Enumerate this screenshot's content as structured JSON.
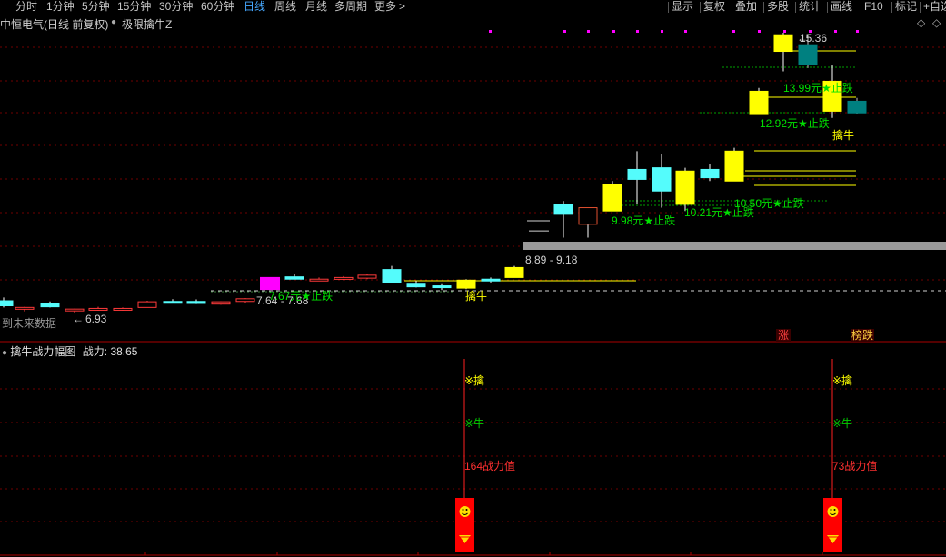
{
  "toolbar": {
    "tabs": [
      {
        "label": "分时",
        "active": false
      },
      {
        "label": "1分钟",
        "active": false
      },
      {
        "label": "5分钟",
        "active": false
      },
      {
        "label": "15分钟",
        "active": false
      },
      {
        "label": "30分钟",
        "active": false
      },
      {
        "label": "60分钟",
        "active": false
      },
      {
        "label": "日线",
        "active": true
      },
      {
        "label": "周线",
        "active": false
      },
      {
        "label": "月线",
        "active": false
      },
      {
        "label": "多周期",
        "active": false
      },
      {
        "label": "更多",
        "active": false
      }
    ],
    "more_arrow": ">",
    "right_buttons": [
      "显示",
      "复权",
      "叠加",
      "多股",
      "统计",
      "画线",
      "F10",
      "标记",
      "+自选"
    ]
  },
  "infobar": {
    "stock_title": "中恒电气(日线 前复权)",
    "indicator_name": "极限擒牛Z"
  },
  "price_panel": {
    "future_data_label": "到未来数据",
    "low_label": "6.93",
    "high_label": "15.36",
    "range_labels": [
      "7.64 - 7.68",
      "8.89 - 9.18"
    ],
    "stop_labels": [
      "7.67元★止跌",
      "9.98元★止跌",
      "10.21元★止跌",
      "10.50元★止跌",
      "12.92元★止跌",
      "13.99元★止跌"
    ],
    "signal_labels": [
      "擒牛",
      "擒牛"
    ],
    "badge_labels": [
      "涨",
      "榜跌"
    ]
  },
  "indicator_panel": {
    "title": "擒牛战力幅图",
    "value_label": "战力:",
    "value": "38.65",
    "signals": [
      {
        "line1": "※擒",
        "line2": "※牛",
        "line3": "164战力值"
      },
      {
        "line1": "※擒",
        "line2": "※牛",
        "line3": "73战力值"
      }
    ]
  },
  "colors": {
    "up_candle": "#ffff00",
    "down_candle": "#54fcfc",
    "small_candle": "#ff3a3a",
    "signal_magenta": "#ff00ff",
    "teal_candle": "#008080",
    "stop_text": "#00e000",
    "grid_red": "#700000"
  },
  "chart_data": {
    "type": "candlestick",
    "candles": [
      {
        "o": 7.3,
        "h": 7.4,
        "l": 7.1,
        "c": 7.15,
        "kind": "cyan"
      },
      {
        "o": 7.05,
        "h": 7.12,
        "l": 6.98,
        "c": 7.1,
        "kind": "red"
      },
      {
        "o": 7.22,
        "h": 7.28,
        "l": 7.1,
        "c": 7.12,
        "kind": "cyan"
      },
      {
        "o": 7.02,
        "h": 7.06,
        "l": 6.93,
        "c": 7.05,
        "kind": "red"
      },
      {
        "o": 7.06,
        "h": 7.12,
        "l": 7.0,
        "c": 7.07,
        "kind": "red"
      },
      {
        "o": 7.05,
        "h": 7.1,
        "l": 7.0,
        "c": 7.07,
        "kind": "red"
      },
      {
        "o": 7.1,
        "h": 7.3,
        "l": 7.1,
        "c": 7.27,
        "kind": "red"
      },
      {
        "o": 7.28,
        "h": 7.35,
        "l": 7.25,
        "c": 7.26,
        "kind": "cyan"
      },
      {
        "o": 7.28,
        "h": 7.34,
        "l": 7.2,
        "c": 7.22,
        "kind": "cyan"
      },
      {
        "o": 7.2,
        "h": 7.28,
        "l": 7.18,
        "c": 7.27,
        "kind": "red"
      },
      {
        "o": 7.28,
        "h": 7.38,
        "l": 7.24,
        "c": 7.36,
        "kind": "red"
      },
      {
        "o": 7.64,
        "h": 8.0,
        "l": 7.64,
        "c": 8.0,
        "kind": "magenta"
      },
      {
        "o": 8.02,
        "h": 8.12,
        "l": 7.95,
        "c": 7.95,
        "kind": "cyan"
      },
      {
        "o": 7.92,
        "h": 8.0,
        "l": 7.9,
        "c": 7.95,
        "kind": "red"
      },
      {
        "o": 7.96,
        "h": 8.04,
        "l": 7.92,
        "c": 8.0,
        "kind": "red"
      },
      {
        "o": 7.98,
        "h": 8.1,
        "l": 7.95,
        "c": 8.07,
        "kind": "red"
      },
      {
        "o": 8.24,
        "h": 8.35,
        "l": 7.85,
        "c": 7.86,
        "kind": "cyan"
      },
      {
        "o": 7.8,
        "h": 7.9,
        "l": 7.7,
        "c": 7.72,
        "kind": "cyan"
      },
      {
        "o": 7.72,
        "h": 7.8,
        "l": 7.62,
        "c": 7.75,
        "kind": "cyan"
      },
      {
        "o": 7.68,
        "h": 7.95,
        "l": 7.65,
        "c": 7.92,
        "kind": "yellow"
      },
      {
        "o": 7.95,
        "h": 8.0,
        "l": 7.85,
        "c": 7.9,
        "kind": "cyan"
      },
      {
        "o": 8.0,
        "h": 8.35,
        "l": 8.0,
        "c": 8.3,
        "kind": "yellow"
      },
      {
        "o": 9.4,
        "h": 9.4,
        "l": 9.4,
        "c": 9.4,
        "kind": "dash"
      },
      {
        "o": 10.2,
        "h": 10.3,
        "l": 9.2,
        "c": 9.9,
        "kind": "cyan"
      },
      {
        "o": 9.6,
        "h": 10.1,
        "l": 9.2,
        "c": 10.1,
        "kind": "hollow"
      },
      {
        "o": 10.0,
        "h": 10.9,
        "l": 10.0,
        "c": 10.8,
        "kind": "yellow"
      },
      {
        "o": 11.25,
        "h": 11.8,
        "l": 10.2,
        "c": 10.95,
        "kind": "cyan"
      },
      {
        "o": 11.3,
        "h": 11.7,
        "l": 10.1,
        "c": 10.6,
        "kind": "cyan"
      },
      {
        "o": 10.2,
        "h": 11.3,
        "l": 10.0,
        "c": 11.2,
        "kind": "yellow"
      },
      {
        "o": 11.25,
        "h": 11.4,
        "l": 10.9,
        "c": 11.0,
        "kind": "cyan"
      },
      {
        "o": 10.9,
        "h": 11.9,
        "l": 10.9,
        "c": 11.8,
        "kind": "yellow"
      },
      {
        "o": 12.9,
        "h": 13.7,
        "l": 12.9,
        "c": 13.6,
        "kind": "yellow"
      },
      {
        "o": 14.8,
        "h": 15.36,
        "l": 14.2,
        "c": 15.3,
        "kind": "yellow"
      },
      {
        "o": 15.0,
        "h": 15.3,
        "l": 14.3,
        "c": 14.4,
        "kind": "teal"
      },
      {
        "o": 13.0,
        "h": 14.4,
        "l": 12.8,
        "c": 13.9,
        "kind": "yellow"
      },
      {
        "o": 13.3,
        "h": 13.4,
        "l": 12.9,
        "c": 12.95,
        "kind": "teal"
      }
    ],
    "resistance_band": {
      "low": 8.89,
      "high": 9.18
    }
  }
}
